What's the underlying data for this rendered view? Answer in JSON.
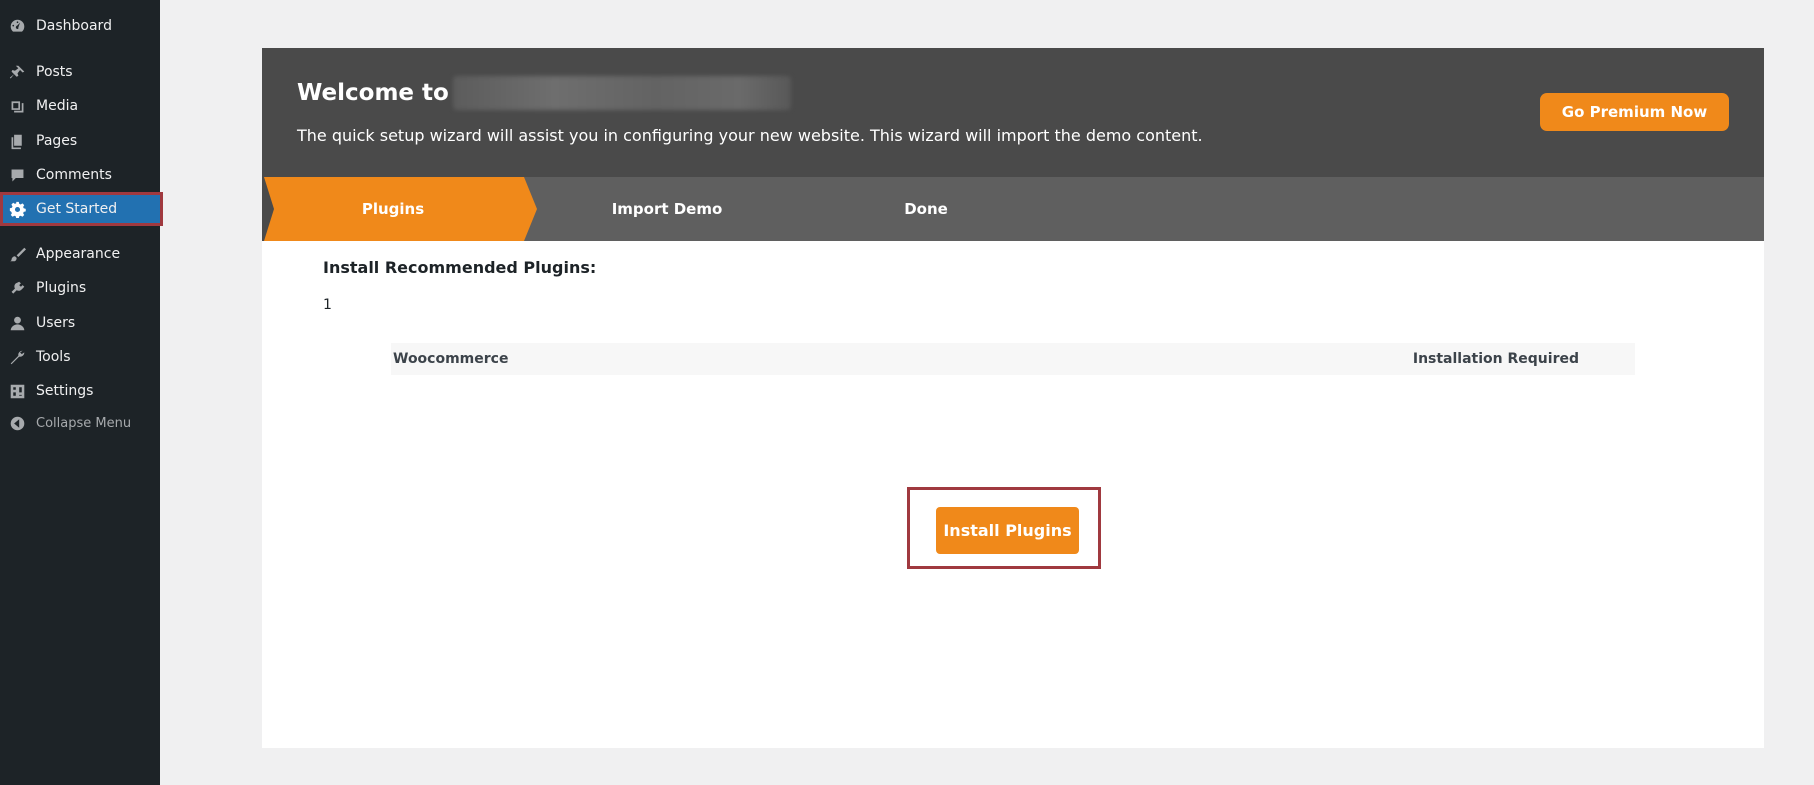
{
  "sidebar": {
    "items": [
      {
        "label": "Dashboard",
        "icon": "dashboard-icon"
      },
      {
        "label": "Posts",
        "icon": "pin-icon"
      },
      {
        "label": "Media",
        "icon": "media-icon"
      },
      {
        "label": "Pages",
        "icon": "pages-icon"
      },
      {
        "label": "Comments",
        "icon": "comment-icon"
      },
      {
        "label": "Get Started",
        "icon": "gear-icon",
        "active": true
      },
      {
        "label": "Appearance",
        "icon": "brush-icon"
      },
      {
        "label": "Plugins",
        "icon": "plug-icon"
      },
      {
        "label": "Users",
        "icon": "user-icon"
      },
      {
        "label": "Tools",
        "icon": "wrench-icon"
      },
      {
        "label": "Settings",
        "icon": "settings-icon"
      }
    ],
    "collapse_label": "Collapse Menu"
  },
  "header": {
    "title": "Welcome to",
    "description": "The quick setup wizard will assist you in configuring your new website. This wizard will import the demo content.",
    "premium_label": "Go Premium Now"
  },
  "steps": [
    {
      "label": "Plugins",
      "active": true
    },
    {
      "label": "Import Demo",
      "active": false
    },
    {
      "label": "Done",
      "active": false
    }
  ],
  "content": {
    "section_title": "Install Recommended Plugins:",
    "count": "1",
    "plugins": [
      {
        "name": "Woocommerce",
        "status": "Installation Required"
      }
    ],
    "install_label": "Install Plugins"
  },
  "colors": {
    "sidebar_bg": "#1d2327",
    "active_menu": "#2271b1",
    "accent_orange": "#f0891a",
    "header_bg": "#4a4a4a",
    "steps_bg": "#5f5f5f",
    "highlight_border": "#a0393f"
  }
}
